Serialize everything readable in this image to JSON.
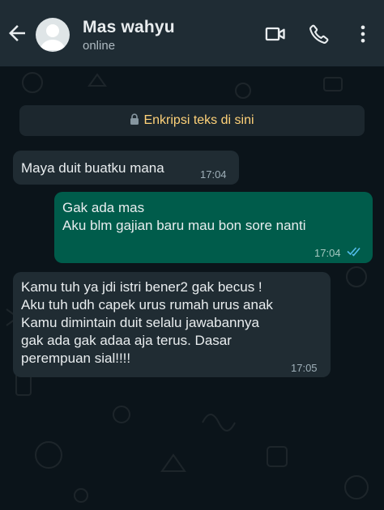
{
  "header": {
    "contact_name": "Mas wahyu",
    "status": "online",
    "back_icon": "arrow-left-icon",
    "video_call_icon": "video-camera-icon",
    "voice_call_icon": "phone-icon",
    "menu_icon": "more-vertical-icon"
  },
  "encryption_notice": {
    "icon": "lock-icon",
    "text": "Enkripsi teks di sini"
  },
  "messages": [
    {
      "direction": "incoming",
      "text": "Maya duit buatku mana",
      "time": "17:04"
    },
    {
      "direction": "outgoing",
      "lines": [
        "Gak ada mas",
        "Aku blm gajian baru mau bon sore nanti"
      ],
      "time": "17:04",
      "read_receipt": "double-check-read-icon"
    },
    {
      "direction": "incoming",
      "lines": [
        "Kamu tuh ya jdi istri bener2 gak becus !",
        "Aku tuh udh capek urus rumah urus anak",
        "Kamu dimintain duit selalu jawabannya",
        "gak ada gak adaa aja terus. Dasar",
        "perempuan sial!!!!"
      ],
      "time": "17:05"
    }
  ],
  "colors": {
    "header_bg": "#1f2c34",
    "chat_bg": "#0b141a",
    "incoming_bubble": "#202c33",
    "outgoing_bubble": "#005c4b",
    "read_tick": "#53bdeb",
    "encryption_text": "#ffd279"
  }
}
